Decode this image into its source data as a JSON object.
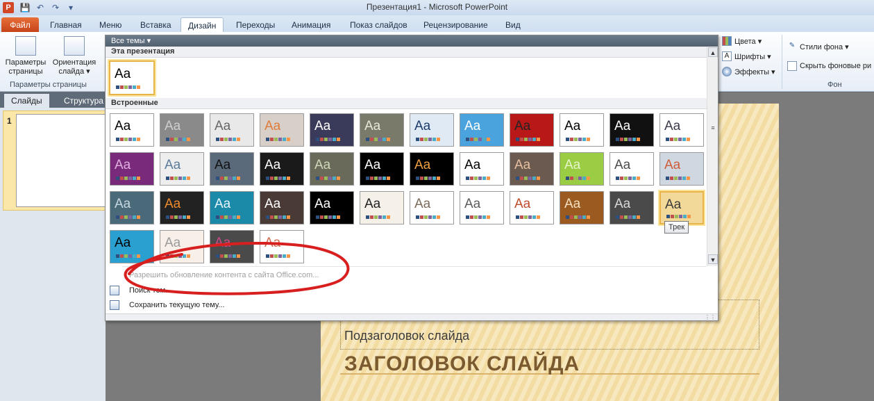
{
  "window": {
    "title": "Презентация1 - Microsoft PowerPoint",
    "app_icon": "P"
  },
  "quick_access": [
    "save-icon",
    "undo-icon",
    "redo-icon",
    "customize-icon"
  ],
  "tabs": [
    {
      "label": "Файл"
    },
    {
      "label": "Главная"
    },
    {
      "label": "Меню"
    },
    {
      "label": "Вставка"
    },
    {
      "label": "Дизайн"
    },
    {
      "label": "Переходы"
    },
    {
      "label": "Анимация"
    },
    {
      "label": "Показ слайдов"
    },
    {
      "label": "Рецензирование"
    },
    {
      "label": "Вид"
    }
  ],
  "ribbon": {
    "page_setup": {
      "label_line1": "Параметры",
      "label_line2": "страницы"
    },
    "orientation": {
      "label_line1": "Ориентация",
      "label_line2": "слайда ▾"
    },
    "group_page_setup": "Параметры страницы",
    "colors": "Цвета ▾",
    "fonts": "Шрифты ▾",
    "effects": "Эффекты ▾",
    "bg_styles": "Стили фона ▾",
    "hide_bg": "Скрыть фоновые ри",
    "group_background": "Фон"
  },
  "left_pane": {
    "tab_slides": "Слайды",
    "tab_outline": "Структура",
    "slide_number": "1"
  },
  "slide": {
    "subtitle": "Подзаголовок слайда",
    "title": "ЗАГОЛОВОК СЛАЙДА"
  },
  "gallery": {
    "header": "Все темы ▾",
    "section_this": "Эта презентация",
    "section_builtin": "Встроенные",
    "tooltip": "Трек",
    "menu": {
      "enable_updates": "Разрешить обновление контента с сайта Office.com...",
      "browse": "Поиск тем...",
      "save": "Сохранить текущую тему..."
    },
    "current_theme": {
      "aa": "Aa",
      "bg": "#ffffff",
      "fg": "#000000"
    },
    "themes": [
      {
        "aa": "Aa",
        "bg": "#ffffff",
        "fg": "#000000"
      },
      {
        "aa": "Aa",
        "bg": "#8a8a8a",
        "fg": "#cfcfcf"
      },
      {
        "aa": "Aa",
        "bg": "#e9e9e9",
        "fg": "#666666"
      },
      {
        "aa": "Aa",
        "bg": "#d8d0c8",
        "fg": "#e07a3a"
      },
      {
        "aa": "Aa",
        "bg": "#3a3a5a",
        "fg": "#ffffff"
      },
      {
        "aa": "Aa",
        "bg": "#7a7a6a",
        "fg": "#e8e8d8"
      },
      {
        "aa": "Aa",
        "bg": "#dfeaf5",
        "fg": "#1a3a6a"
      },
      {
        "aa": "Aa",
        "bg": "#4aa3dc",
        "fg": "#ffffff"
      },
      {
        "aa": "Aa",
        "bg": "#b81818",
        "fg": "#222222"
      },
      {
        "aa": "Aa",
        "bg": "#ffffff",
        "fg": "#000000"
      },
      {
        "aa": "Aa",
        "bg": "#111111",
        "fg": "#ffffff"
      },
      {
        "aa": "Aa",
        "bg": "#ffffff",
        "fg": "#3a3a4a"
      },
      {
        "aa": "Aa",
        "bg": "#7a2a7a",
        "fg": "#e0b0e0"
      },
      {
        "aa": "Aa",
        "bg": "#eeeeee",
        "fg": "#5a7a9a"
      },
      {
        "aa": "Aa",
        "bg": "#5a6a7a",
        "fg": "#111111"
      },
      {
        "aa": "Aa",
        "bg": "#1a1a1a",
        "fg": "#ffffff"
      },
      {
        "aa": "Aa",
        "bg": "#6a6a5a",
        "fg": "#cfd8b8"
      },
      {
        "aa": "Aa",
        "bg": "#000000",
        "fg": "#ffffff"
      },
      {
        "aa": "Aa",
        "bg": "#000000",
        "fg": "#f0a040"
      },
      {
        "aa": "Aa",
        "bg": "#ffffff",
        "fg": "#000000"
      },
      {
        "aa": "Aa",
        "bg": "#6a5a50",
        "fg": "#e8c0a0"
      },
      {
        "aa": "Aa",
        "bg": "#9acc44",
        "fg": "#e8f5c8"
      },
      {
        "aa": "Aa",
        "bg": "#ffffff",
        "fg": "#4a4a4a"
      },
      {
        "aa": "Aa",
        "bg": "#cfd8e0",
        "fg": "#d05a3a"
      },
      {
        "aa": "Aa",
        "bg": "#4a6a7a",
        "fg": "#c8d8e0"
      },
      {
        "aa": "Aa",
        "bg": "#222222",
        "fg": "#f08a2a"
      },
      {
        "aa": "Aa",
        "bg": "#1a8aa8",
        "fg": "#e8f5ff"
      },
      {
        "aa": "Aa",
        "bg": "#4a3a35",
        "fg": "#ffffff"
      },
      {
        "aa": "Aa",
        "bg": "#000000",
        "fg": "#ffffff"
      },
      {
        "aa": "Aa",
        "bg": "#f5f0e8",
        "fg": "#222222"
      },
      {
        "aa": "Aa",
        "bg": "#ffffff",
        "fg": "#7a6a5a"
      },
      {
        "aa": "Aa",
        "bg": "#ffffff",
        "fg": "#5a5a5a"
      },
      {
        "aa": "Aa",
        "bg": "#ffffff",
        "fg": "#c04a2a"
      },
      {
        "aa": "Aa",
        "bg": "#9a5a20",
        "fg": "#f8e0c0"
      },
      {
        "aa": "Aa",
        "bg": "#4a4a4a",
        "fg": "#d8d8d8"
      },
      {
        "aa": "Aa",
        "bg": "#f2d99a",
        "fg": "#3a3a3a",
        "selected": true
      },
      {
        "aa": "Aa",
        "bg": "#2aa0d0",
        "fg": "#000000"
      },
      {
        "aa": "Aa",
        "bg": "#f8f0e8",
        "fg": "#9a9a9a"
      },
      {
        "aa": "Aa",
        "bg": "#4a4a4a",
        "fg": "#d04a8a"
      },
      {
        "aa": "Aa",
        "bg": "#ffffff",
        "fg": "#c86a4a"
      }
    ],
    "swatch": [
      "#2f4f7f",
      "#c0504d",
      "#9bbb59",
      "#8064a2",
      "#4bacc6",
      "#f79646"
    ]
  }
}
